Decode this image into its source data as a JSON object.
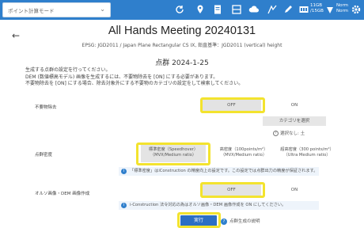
{
  "toolbar": {
    "mode_select_value": "ポイント計算モード",
    "caret": "⌄",
    "status_line1": "11GB",
    "status_line2": "/15GB",
    "status2_line1": "Norm",
    "status2_line2": "Norm"
  },
  "header": {
    "back": "←",
    "title": "All Hands Meeting 20240131",
    "subtitle": "EPSG: JGD2011 / Japan Plane Rectangular CS IX, 鉛直基準：JGD2011 (vertical) height"
  },
  "section": {
    "heading": "点群 2024-1-25",
    "intro_line1": "生成する点群の設定を行ってください。",
    "intro_line2": "DEM (数値標高モデル) 画像を生成するには、不要物除去を [ON] にする必要があります。",
    "intro_line3": "不要物除去を [ON] にする場合、除去対象外にする不要物のカテゴリの設定をして検索してください。"
  },
  "noise_removal": {
    "label": "不要物除去",
    "off": "OFF",
    "on": "ON",
    "category_button": "カテゴリを選択",
    "help": "選択なし: 土"
  },
  "density": {
    "label": "点群密度",
    "options": [
      {
        "line1": "標準密度（Speedhover）",
        "line2": "（MVX/Medium ratio）"
      },
      {
        "line1": "高密度（100points/m²）",
        "line2": "（MVX/Medium ratio）"
      },
      {
        "line1": "超高密度（300 points/m²）",
        "line2": "（Ultra Medium ratio）"
      }
    ],
    "info": "「標準密度」はiConstruction の精度向上の設定です。この設定では点群出力の精度が保証されます。"
  },
  "ortho": {
    "label": "オルソ画像・DEM 画像作成",
    "off": "OFF",
    "on": "ON",
    "info": "i-Construction 法令対応の為はオルソ画像・DEM 画像作成を ON にしてください。"
  },
  "actions": {
    "execute": "実行",
    "help": "点群生成の説明"
  },
  "colors": {
    "accent": "#2f7fcc",
    "highlight": "#f3e32e",
    "execute_button": "#2c6fc4"
  }
}
